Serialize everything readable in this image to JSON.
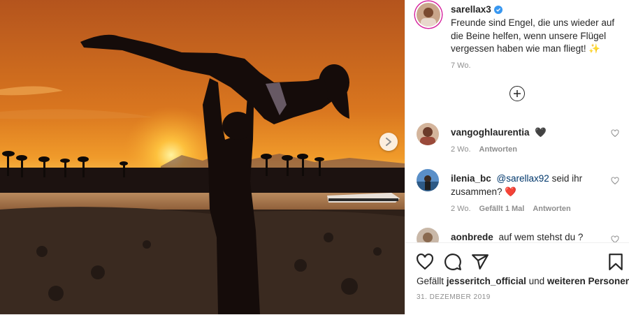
{
  "post": {
    "author": "sarellax3",
    "caption": "Freunde sind Engel, die uns wieder auf die Beine helfen, wenn unsere Flügel vergessen haben wie man fliegt! ✨",
    "caption_time": "7 Wo."
  },
  "comments": [
    {
      "user": "vangoghlaurentia",
      "text": "🖤",
      "time": "2 Wo.",
      "reply": "Antworten"
    },
    {
      "user": "ilenia_bc",
      "mention": "@sarellax92",
      "text": "seid ihr zusammen? ❤️",
      "time": "2 Wo.",
      "likes": "Gefällt 1 Mal",
      "reply": "Antworten"
    },
    {
      "user": "aonbrede",
      "text": "auf wem stehst du ?"
    }
  ],
  "likes_line": {
    "prefix": "Gefällt",
    "user": "jesseritch_official",
    "mid": "und",
    "rest": "weiteren Personen"
  },
  "date": "31. DEZEMBER 2019",
  "icons": {
    "verified": "verified-badge-icon",
    "add": "plus-circle-icon",
    "like": "heart-icon",
    "comment": "speech-bubble-icon",
    "share": "paper-plane-icon",
    "save": "bookmark-icon",
    "next": "chevron-right-icon"
  }
}
